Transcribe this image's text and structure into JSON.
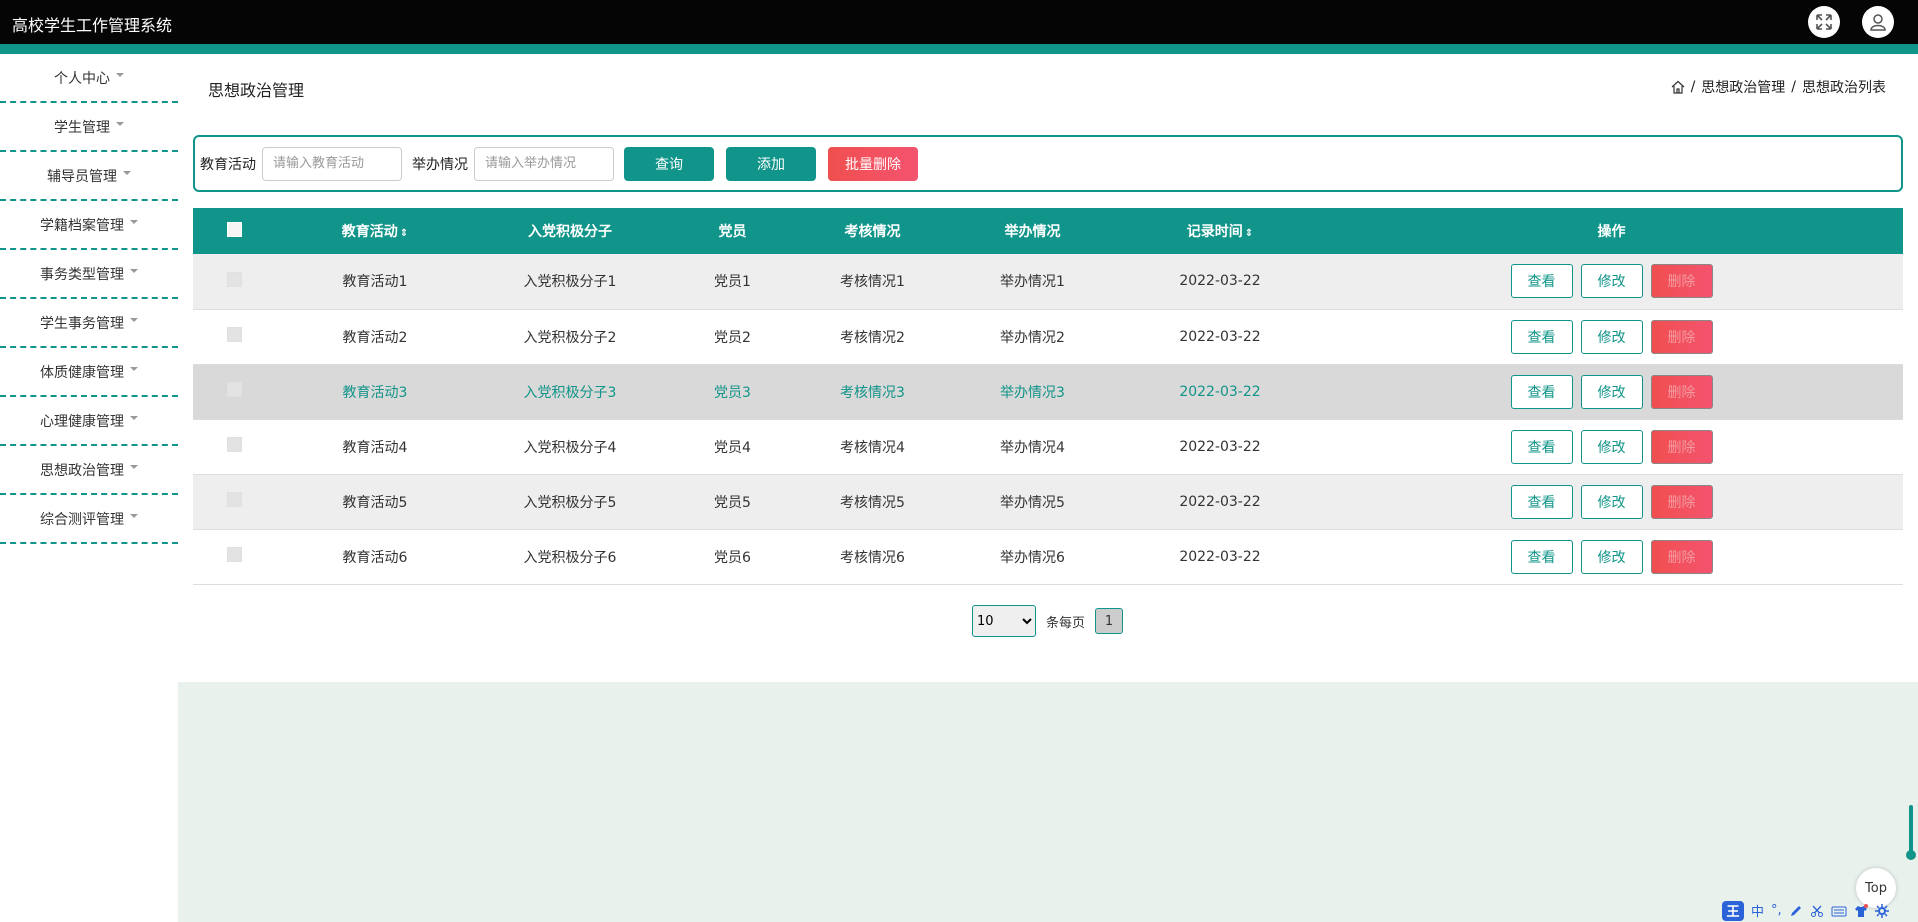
{
  "header": {
    "app_title": "高校学生工作管理系统",
    "fullscreen_icon": "expand-arrows-icon",
    "user_icon": "user-icon"
  },
  "sidebar": {
    "items": [
      {
        "label": "个人中心"
      },
      {
        "label": "学生管理"
      },
      {
        "label": "辅导员管理"
      },
      {
        "label": "学籍档案管理"
      },
      {
        "label": "事务类型管理"
      },
      {
        "label": "学生事务管理"
      },
      {
        "label": "体质健康管理"
      },
      {
        "label": "心理健康管理"
      },
      {
        "label": "思想政治管理"
      },
      {
        "label": "综合测评管理"
      }
    ]
  },
  "page": {
    "title": "思想政治管理",
    "breadcrumb": [
      "思想政治管理",
      "思想政治列表"
    ],
    "breadcrumb_sep": "/"
  },
  "search": {
    "activity_label": "教育活动",
    "activity_placeholder": "请输入教育活动",
    "status_label": "举办情况",
    "status_placeholder": "请输入举办情况",
    "query_label": "查询",
    "add_label": "添加",
    "batch_delete_label": "批量删除"
  },
  "table": {
    "columns": [
      "教育活动",
      "入党积极分子",
      "党员",
      "考核情况",
      "举办情况",
      "记录时间",
      "操作"
    ],
    "sort_glyph": "⇕",
    "rows": [
      {
        "activity": "教育活动1",
        "activist": "入党积极分子1",
        "member": "党员1",
        "assessment": "考核情况1",
        "status": "举办情况1",
        "time": "2022-03-22"
      },
      {
        "activity": "教育活动2",
        "activist": "入党积极分子2",
        "member": "党员2",
        "assessment": "考核情况2",
        "status": "举办情况2",
        "time": "2022-03-22"
      },
      {
        "activity": "教育活动3",
        "activist": "入党积极分子3",
        "member": "党员3",
        "assessment": "考核情况3",
        "status": "举办情况3",
        "time": "2022-03-22"
      },
      {
        "activity": "教育活动4",
        "activist": "入党积极分子4",
        "member": "党员4",
        "assessment": "考核情况4",
        "status": "举办情况4",
        "time": "2022-03-22"
      },
      {
        "activity": "教育活动5",
        "activist": "入党积极分子5",
        "member": "党员5",
        "assessment": "考核情况5",
        "status": "举办情况5",
        "time": "2022-03-22"
      },
      {
        "activity": "教育活动6",
        "activist": "入党积极分子6",
        "member": "党员6",
        "assessment": "考核情况6",
        "status": "举办情况6",
        "time": "2022-03-22"
      }
    ],
    "actions": {
      "view": "查看",
      "edit": "修改",
      "delete": "删除"
    }
  },
  "pager": {
    "page_size": "10",
    "per_page_label": "条每页",
    "current_page": "1"
  },
  "floating": {
    "top_label": "Top"
  },
  "ime": {
    "logo": "王",
    "mode": "中",
    "punct": "°,"
  },
  "colors": {
    "accent": "#119489",
    "danger": "#f04f4f",
    "header_bg": "#050505",
    "bottom_bg": "#e8f1ec"
  }
}
